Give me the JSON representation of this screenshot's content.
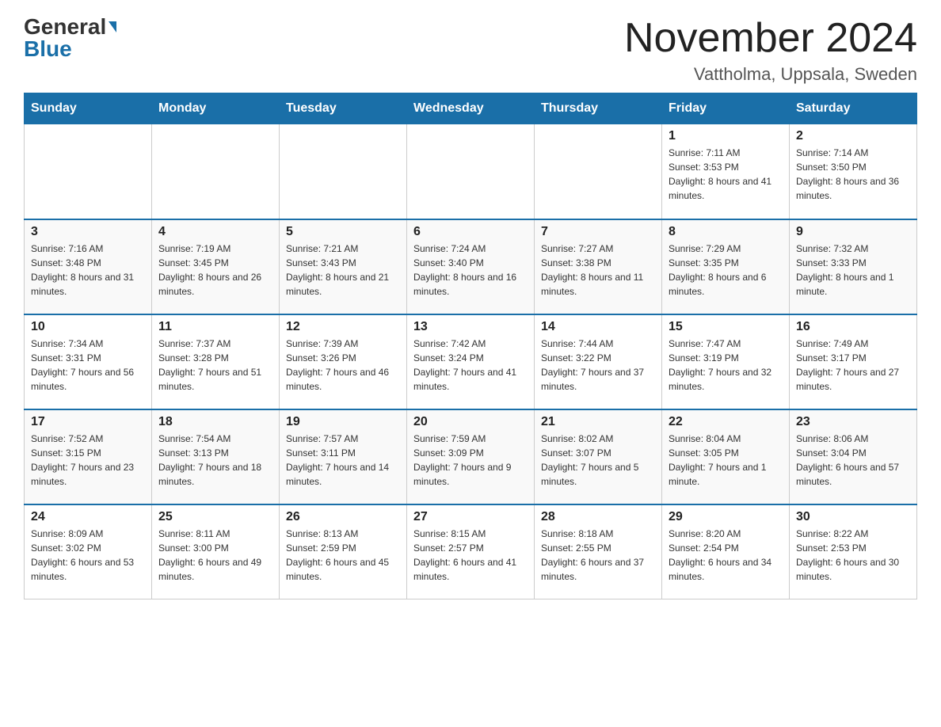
{
  "header": {
    "logo_general": "General",
    "logo_blue": "Blue",
    "title": "November 2024",
    "location": "Vattholma, Uppsala, Sweden"
  },
  "days_of_week": [
    "Sunday",
    "Monday",
    "Tuesday",
    "Wednesday",
    "Thursday",
    "Friday",
    "Saturday"
  ],
  "weeks": [
    [
      {
        "day": "",
        "info": ""
      },
      {
        "day": "",
        "info": ""
      },
      {
        "day": "",
        "info": ""
      },
      {
        "day": "",
        "info": ""
      },
      {
        "day": "",
        "info": ""
      },
      {
        "day": "1",
        "info": "Sunrise: 7:11 AM\nSunset: 3:53 PM\nDaylight: 8 hours and 41 minutes."
      },
      {
        "day": "2",
        "info": "Sunrise: 7:14 AM\nSunset: 3:50 PM\nDaylight: 8 hours and 36 minutes."
      }
    ],
    [
      {
        "day": "3",
        "info": "Sunrise: 7:16 AM\nSunset: 3:48 PM\nDaylight: 8 hours and 31 minutes."
      },
      {
        "day": "4",
        "info": "Sunrise: 7:19 AM\nSunset: 3:45 PM\nDaylight: 8 hours and 26 minutes."
      },
      {
        "day": "5",
        "info": "Sunrise: 7:21 AM\nSunset: 3:43 PM\nDaylight: 8 hours and 21 minutes."
      },
      {
        "day": "6",
        "info": "Sunrise: 7:24 AM\nSunset: 3:40 PM\nDaylight: 8 hours and 16 minutes."
      },
      {
        "day": "7",
        "info": "Sunrise: 7:27 AM\nSunset: 3:38 PM\nDaylight: 8 hours and 11 minutes."
      },
      {
        "day": "8",
        "info": "Sunrise: 7:29 AM\nSunset: 3:35 PM\nDaylight: 8 hours and 6 minutes."
      },
      {
        "day": "9",
        "info": "Sunrise: 7:32 AM\nSunset: 3:33 PM\nDaylight: 8 hours and 1 minute."
      }
    ],
    [
      {
        "day": "10",
        "info": "Sunrise: 7:34 AM\nSunset: 3:31 PM\nDaylight: 7 hours and 56 minutes."
      },
      {
        "day": "11",
        "info": "Sunrise: 7:37 AM\nSunset: 3:28 PM\nDaylight: 7 hours and 51 minutes."
      },
      {
        "day": "12",
        "info": "Sunrise: 7:39 AM\nSunset: 3:26 PM\nDaylight: 7 hours and 46 minutes."
      },
      {
        "day": "13",
        "info": "Sunrise: 7:42 AM\nSunset: 3:24 PM\nDaylight: 7 hours and 41 minutes."
      },
      {
        "day": "14",
        "info": "Sunrise: 7:44 AM\nSunset: 3:22 PM\nDaylight: 7 hours and 37 minutes."
      },
      {
        "day": "15",
        "info": "Sunrise: 7:47 AM\nSunset: 3:19 PM\nDaylight: 7 hours and 32 minutes."
      },
      {
        "day": "16",
        "info": "Sunrise: 7:49 AM\nSunset: 3:17 PM\nDaylight: 7 hours and 27 minutes."
      }
    ],
    [
      {
        "day": "17",
        "info": "Sunrise: 7:52 AM\nSunset: 3:15 PM\nDaylight: 7 hours and 23 minutes."
      },
      {
        "day": "18",
        "info": "Sunrise: 7:54 AM\nSunset: 3:13 PM\nDaylight: 7 hours and 18 minutes."
      },
      {
        "day": "19",
        "info": "Sunrise: 7:57 AM\nSunset: 3:11 PM\nDaylight: 7 hours and 14 minutes."
      },
      {
        "day": "20",
        "info": "Sunrise: 7:59 AM\nSunset: 3:09 PM\nDaylight: 7 hours and 9 minutes."
      },
      {
        "day": "21",
        "info": "Sunrise: 8:02 AM\nSunset: 3:07 PM\nDaylight: 7 hours and 5 minutes."
      },
      {
        "day": "22",
        "info": "Sunrise: 8:04 AM\nSunset: 3:05 PM\nDaylight: 7 hours and 1 minute."
      },
      {
        "day": "23",
        "info": "Sunrise: 8:06 AM\nSunset: 3:04 PM\nDaylight: 6 hours and 57 minutes."
      }
    ],
    [
      {
        "day": "24",
        "info": "Sunrise: 8:09 AM\nSunset: 3:02 PM\nDaylight: 6 hours and 53 minutes."
      },
      {
        "day": "25",
        "info": "Sunrise: 8:11 AM\nSunset: 3:00 PM\nDaylight: 6 hours and 49 minutes."
      },
      {
        "day": "26",
        "info": "Sunrise: 8:13 AM\nSunset: 2:59 PM\nDaylight: 6 hours and 45 minutes."
      },
      {
        "day": "27",
        "info": "Sunrise: 8:15 AM\nSunset: 2:57 PM\nDaylight: 6 hours and 41 minutes."
      },
      {
        "day": "28",
        "info": "Sunrise: 8:18 AM\nSunset: 2:55 PM\nDaylight: 6 hours and 37 minutes."
      },
      {
        "day": "29",
        "info": "Sunrise: 8:20 AM\nSunset: 2:54 PM\nDaylight: 6 hours and 34 minutes."
      },
      {
        "day": "30",
        "info": "Sunrise: 8:22 AM\nSunset: 2:53 PM\nDaylight: 6 hours and 30 minutes."
      }
    ]
  ]
}
